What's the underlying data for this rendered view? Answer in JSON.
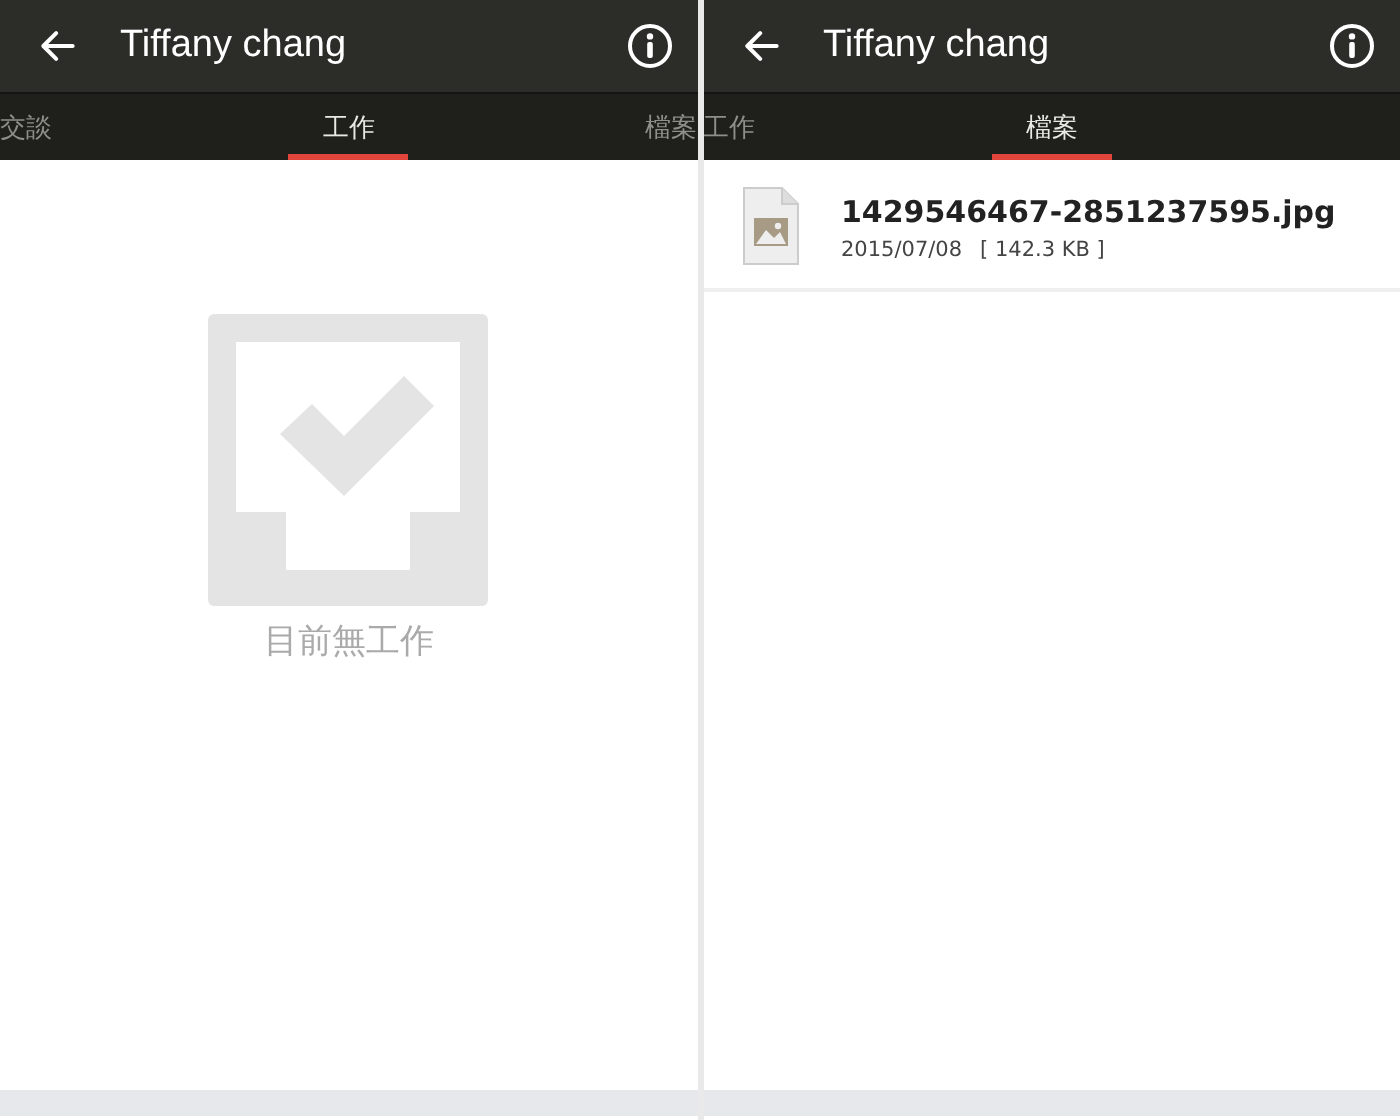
{
  "panels": [
    {
      "title": "Tiffany chang",
      "tabs": [
        {
          "label": "交談",
          "selected": false
        },
        {
          "label": "工作",
          "selected": true
        },
        {
          "label": "檔案",
          "selected": false
        }
      ],
      "content": {
        "kind": "empty",
        "message": "目前無工作"
      }
    },
    {
      "title": "Tiffany chang",
      "tabs": [
        {
          "label": "工作",
          "selected": false
        },
        {
          "label": "檔案",
          "selected": true
        }
      ],
      "content": {
        "kind": "files",
        "files": [
          {
            "name": "1429546467-2851237595.jpg",
            "date": "2015/07/08",
            "size": "[ 142.3 KB ]"
          }
        ]
      }
    }
  ]
}
